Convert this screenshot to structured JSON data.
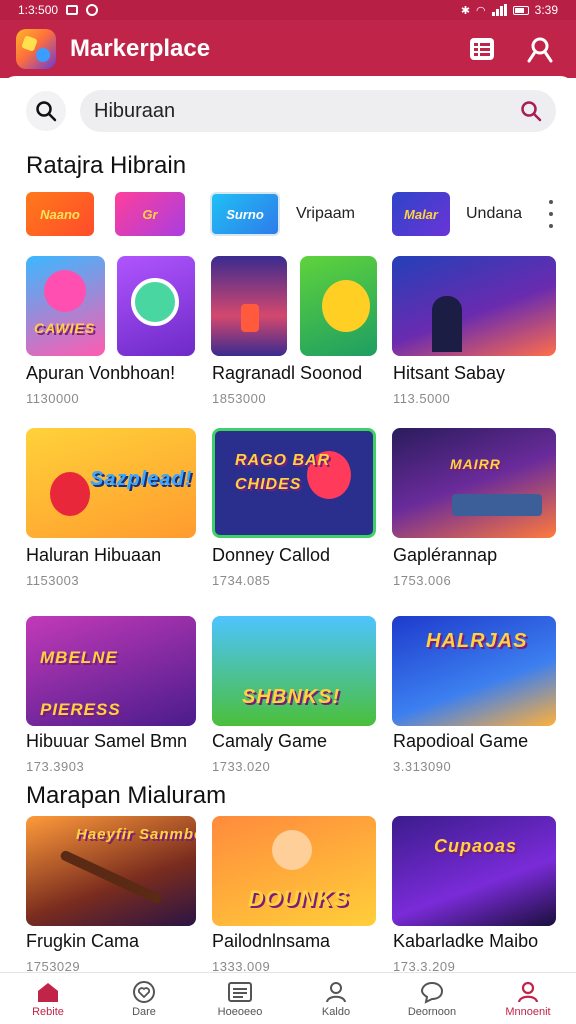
{
  "status": {
    "time_left": "1:3:500",
    "time_right": "3:39"
  },
  "header": {
    "title": "Markerplace"
  },
  "search": {
    "value": "Hiburaan"
  },
  "sections": [
    {
      "title": "Ratajra Hibrain"
    },
    {
      "title": "Marapan Mialuram"
    }
  ],
  "chips": [
    {
      "label": "Naano"
    },
    {
      "label": "Gr"
    },
    {
      "label": "Surno"
    },
    {
      "label": "Vripaam",
      "text": true
    },
    {
      "label": "Malar"
    },
    {
      "label": "Undana",
      "text": true
    }
  ],
  "row1": [
    {
      "art": "CAWIES",
      "name": "Apuran Vonbhoan!",
      "count": "1130000"
    },
    {
      "art": "",
      "name": "Ragranadl Soonod",
      "count": "1853000"
    },
    {
      "art": "",
      "name": "Hitsant Sabay",
      "count": "113.5000"
    }
  ],
  "row2": [
    {
      "art": "Sazplead!",
      "name": "Haluran Hibuaan",
      "count": "1153003"
    },
    {
      "art": "RAGO BAR CHIDES",
      "name": "Donney Callod",
      "count": "1734.085"
    },
    {
      "art": "MAIRR",
      "name": "Gaplérannap",
      "count": "1753.006"
    }
  ],
  "row3": [
    {
      "art": "MBELNE PIERESS",
      "name": "Hibuuar Samel Bmn",
      "count": "173.3903"
    },
    {
      "art": "SHBNKS!",
      "name": "Camaly Game",
      "count": "1733.020"
    },
    {
      "art": "HALRJAS",
      "name": "Rapodioal Game",
      "count": "3.313090"
    }
  ],
  "row4": [
    {
      "art": "Haeyfir Sanmbe",
      "name": "Frugkin Cama",
      "count": "1753029"
    },
    {
      "art": "DOUNKS",
      "name": "Pailodnlnsama",
      "count": "1333.009"
    },
    {
      "art": "Cupaoas",
      "name": "Kabarladke Maibo",
      "count": "173.3.209"
    }
  ],
  "nav": [
    {
      "label": "Rebite",
      "icon": "home-icon",
      "active": true
    },
    {
      "label": "Dare",
      "icon": "heart-icon"
    },
    {
      "label": "Hoeoeeo",
      "icon": "list-icon"
    },
    {
      "label": "Kaldo",
      "icon": "person-icon"
    },
    {
      "label": "Deornoon",
      "icon": "chat-icon"
    },
    {
      "label": "Mnnoenit",
      "icon": "profile-icon",
      "active": true
    }
  ],
  "colors": {
    "brand": "#c12449",
    "statusbar": "#b81f45"
  }
}
